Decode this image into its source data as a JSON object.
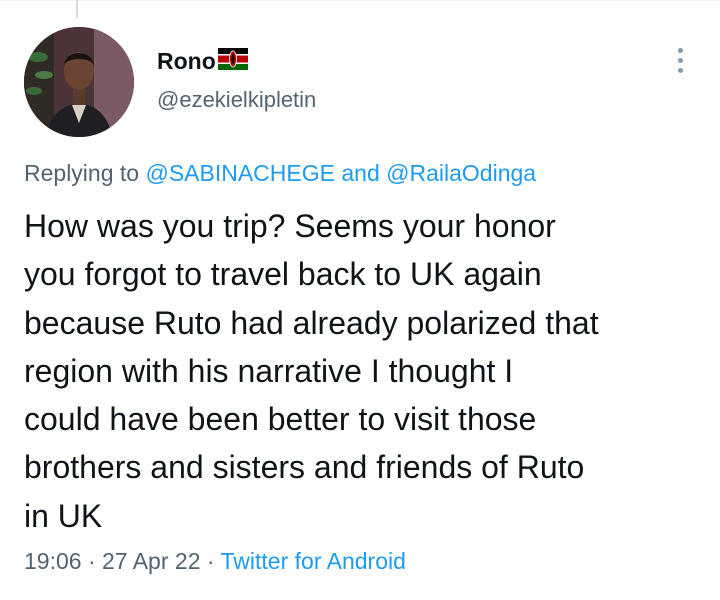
{
  "tweet": {
    "author": {
      "display_name": "Rono",
      "flag_icon": "kenya-flag-icon",
      "handle": "@ezekielkipletin"
    },
    "replying_prefix": "Replying to",
    "mention_1": "@SABINACHEGE",
    "replying_connector": "and",
    "mention_2": "@RailaOdinga",
    "text_lines": [
      "How was you trip? Seems your honor",
      "you forgot to travel back to UK again",
      "because Ruto had already polarized that",
      "region with his narrative I thought I",
      "could have been better to visit those",
      "brothers and sisters and friends of Ruto",
      "in UK"
    ],
    "time": "19:06",
    "date": "27 Apr 22",
    "separator": "·",
    "source": "Twitter for Android"
  },
  "colors": {
    "text": "#0f1419",
    "secondary": "#536471",
    "link": "#1d9bf0"
  }
}
